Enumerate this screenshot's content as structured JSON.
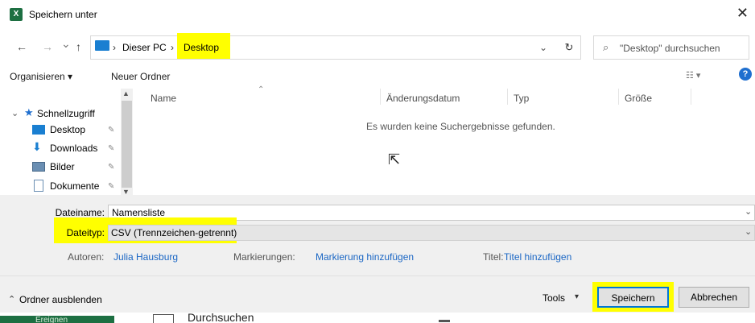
{
  "window": {
    "title": "Speichern unter",
    "app_icon": "excel-icon",
    "close_glyph": "✕"
  },
  "nav": {
    "back": "←",
    "forward": "→",
    "recent": "⌄",
    "up": "↑",
    "breadcrumb": [
      "Dieser PC",
      "Desktop"
    ],
    "sep": "›",
    "search_placeholder": "\"Desktop\" durchsuchen"
  },
  "toolbar": {
    "organize": "Organisieren ▾",
    "new_folder": "Neuer Ordner"
  },
  "sidebar": {
    "quick_access": "Schnellzugriff",
    "items": [
      {
        "label": "Desktop",
        "icon": "desktop-icon"
      },
      {
        "label": "Downloads",
        "icon": "download-icon"
      },
      {
        "label": "Bilder",
        "icon": "pictures-icon"
      },
      {
        "label": "Dokumente",
        "icon": "documents-icon"
      }
    ]
  },
  "columns": [
    "Name",
    "Änderungsdatum",
    "Typ",
    "Größe"
  ],
  "empty_message": "Es wurden keine Suchergebnisse gefunden.",
  "form": {
    "filename_label": "Dateiname:",
    "filename_value": "Namensliste",
    "filetype_label": "Dateityp:",
    "filetype_value": "CSV (Trennzeichen-getrennt)",
    "authors_label": "Autoren:",
    "authors_value": "Julia Hausburg",
    "tags_label": "Markierungen:",
    "tags_value": "Markierung hinzufügen",
    "title_label": "Titel:",
    "title_value": "Titel hinzufügen"
  },
  "footer": {
    "hide_folders": "Ordner ausblenden",
    "tools": "Tools",
    "save": "Speichern",
    "cancel": "Abbrechen"
  },
  "background": {
    "left_text": "Ereignen",
    "browse_text": "Durchsuchen"
  },
  "colors": {
    "highlight": "#ffff00",
    "link": "#1a66c4",
    "accent": "#1f6fcf"
  }
}
